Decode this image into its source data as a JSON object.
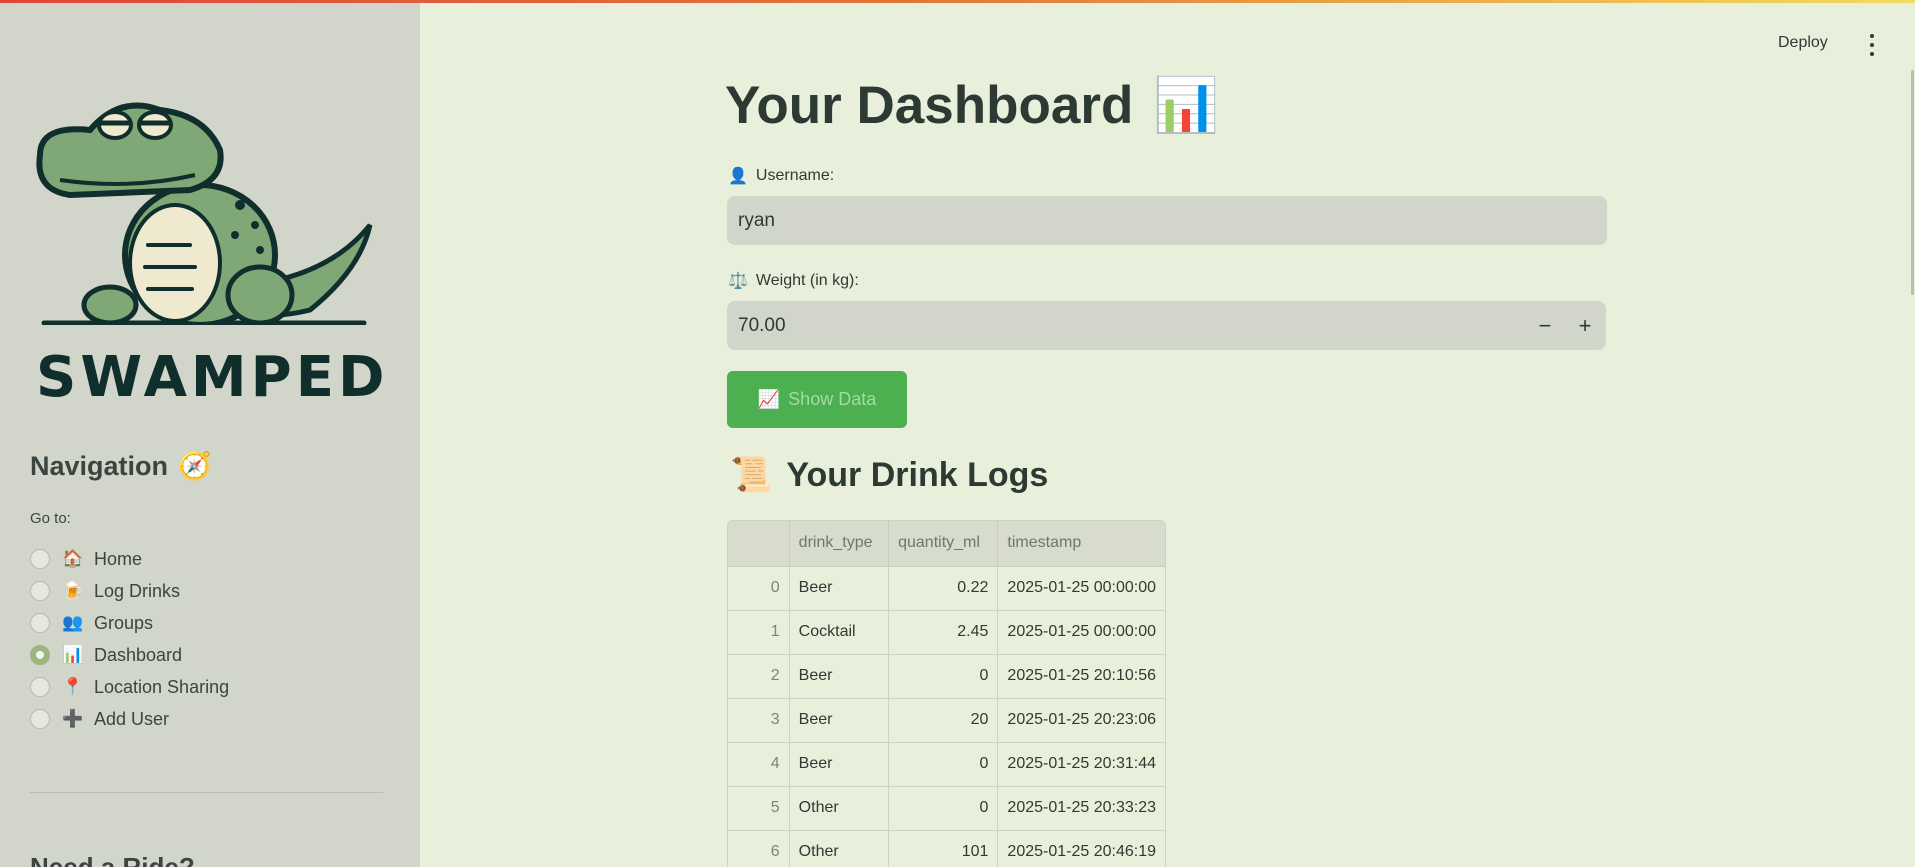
{
  "header": {
    "deploy_label": "Deploy"
  },
  "sidebar": {
    "logo_text": "SWAMPED",
    "nav_title": "Navigation",
    "nav_icon": "🧭",
    "goto_label": "Go to:",
    "items": [
      {
        "label": "Home",
        "emoji": "🏠",
        "selected": false
      },
      {
        "label": "Log Drinks",
        "emoji": "🍺",
        "selected": false
      },
      {
        "label": "Groups",
        "emoji": "👥",
        "selected": false
      },
      {
        "label": "Dashboard",
        "emoji": "📊",
        "selected": true
      },
      {
        "label": "Location Sharing",
        "emoji": "📍",
        "selected": false
      },
      {
        "label": "Add User",
        "emoji": "➕",
        "selected": false
      }
    ],
    "ride_title": "Need a Ride?"
  },
  "main": {
    "title": "Your Dashboard",
    "title_emoji": "📊",
    "username_label": "Username:",
    "username_icon": "👤",
    "username_value": "ryan",
    "weight_label": "Weight (in kg):",
    "weight_icon": "⚖️",
    "weight_value": "70.00",
    "show_button_label": "Show Data",
    "show_button_icon": "📈",
    "logs_title": "Your Drink Logs",
    "logs_icon": "📜",
    "table": {
      "columns": [
        "",
        "drink_type",
        "quantity_ml",
        "timestamp"
      ],
      "rows": [
        [
          "0",
          "Beer",
          "0.22",
          "2025-01-25 00:00:00"
        ],
        [
          "1",
          "Cocktail",
          "2.45",
          "2025-01-25 00:00:00"
        ],
        [
          "2",
          "Beer",
          "0",
          "2025-01-25 20:10:56"
        ],
        [
          "3",
          "Beer",
          "20",
          "2025-01-25 20:23:06"
        ],
        [
          "4",
          "Beer",
          "0",
          "2025-01-25 20:31:44"
        ],
        [
          "5",
          "Other",
          "0",
          "2025-01-25 20:33:23"
        ],
        [
          "6",
          "Other",
          "101",
          "2025-01-25 20:46:19"
        ]
      ]
    }
  },
  "colors": {
    "accent_green": "#4caf50",
    "sidebar_bg": "#d2d5c9",
    "main_bg": "#e8f0dc",
    "logo_dark": "#0f2e2c",
    "croc_green": "#7fa876"
  }
}
